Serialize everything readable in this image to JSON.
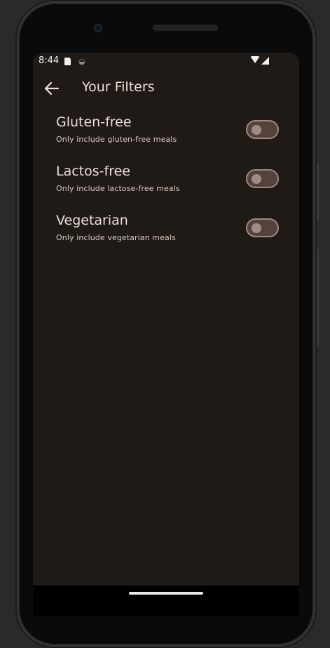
{
  "status_bar": {
    "time": "8:44"
  },
  "app_bar": {
    "title": "Your Filters",
    "back_icon": "arrow-left-icon"
  },
  "filters": [
    {
      "title": "Gluten-free",
      "subtitle": "Only include gluten-free meals",
      "enabled": false
    },
    {
      "title": "Lactos-free",
      "subtitle": "Only include lactose-free meals",
      "enabled": false
    },
    {
      "title": "Vegetarian",
      "subtitle": "Only include vegetarian meals",
      "enabled": false
    }
  ],
  "colors": {
    "background": "#201a17",
    "text_primary": "#ece0da",
    "switch_track": "#53433c",
    "switch_thumb": "#9e8d86"
  }
}
